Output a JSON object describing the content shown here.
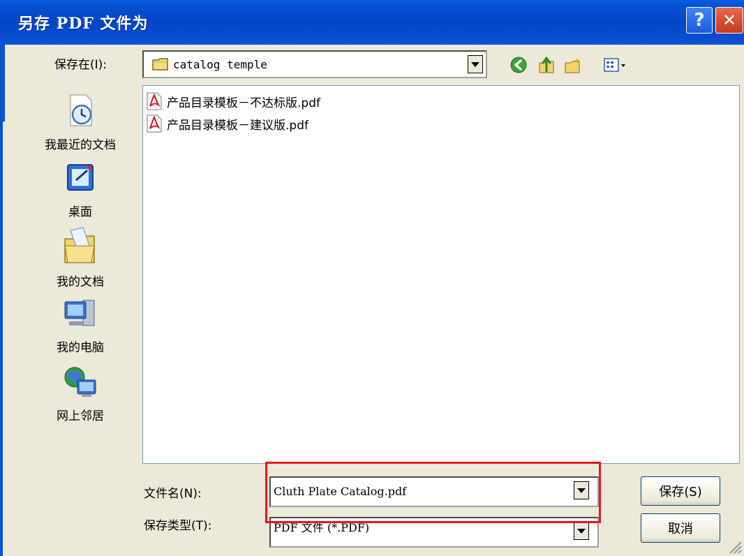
{
  "window": {
    "title": "另存 PDF 文件为",
    "help_glyph": "?",
    "close_glyph": "✕"
  },
  "location": {
    "label": "保存在(I):",
    "value": "catalog temple"
  },
  "toolbar": {
    "icons": [
      "back-icon",
      "up-folder-icon",
      "new-folder-icon",
      "view-menu-icon"
    ]
  },
  "places": [
    {
      "label": "我最近的文档",
      "icon": "recent-documents-icon"
    },
    {
      "label": "桌面",
      "icon": "desktop-icon"
    },
    {
      "label": "我的文档",
      "icon": "my-documents-icon"
    },
    {
      "label": "我的电脑",
      "icon": "my-computer-icon"
    },
    {
      "label": "网上邻居",
      "icon": "network-places-icon"
    }
  ],
  "files": [
    {
      "name": "产品目录模板－不达标版.pdf",
      "icon": "pdf-file-icon"
    },
    {
      "name": "产品目录模板－建议版.pdf",
      "icon": "pdf-file-icon"
    }
  ],
  "filename": {
    "label": "文件名(N):",
    "value": "Cluth Plate Catalog.pdf"
  },
  "filetype": {
    "label": "保存类型(T):",
    "value": "PDF 文件 (*.PDF)"
  },
  "buttons": {
    "save": "保存(S)",
    "cancel": "取消"
  },
  "colors": {
    "titlebar": "#0346c4",
    "highlight": "#e8141e",
    "dialog_bg": "#ece9d8"
  }
}
